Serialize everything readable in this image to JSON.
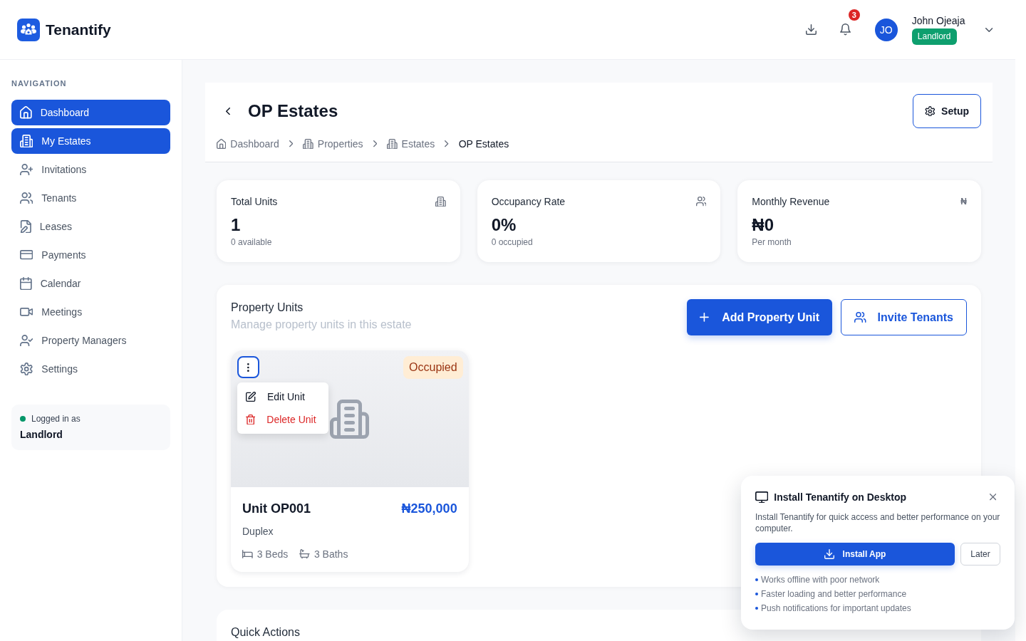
{
  "header": {
    "app_name": "Tenantify",
    "notification_count": "3",
    "user": {
      "initials": "JO",
      "name": "John Ojeaja",
      "role": "Landlord"
    }
  },
  "sidebar": {
    "heading": "NAVIGATION",
    "items": [
      {
        "label": "Dashboard",
        "selected": true
      },
      {
        "label": "My Estates",
        "selected": true
      },
      {
        "label": "Invitations",
        "selected": false
      },
      {
        "label": "Tenants",
        "selected": false
      },
      {
        "label": "Leases",
        "selected": false
      },
      {
        "label": "Payments",
        "selected": false
      },
      {
        "label": "Calendar",
        "selected": false
      },
      {
        "label": "Meetings",
        "selected": false
      },
      {
        "label": "Property Managers",
        "selected": false
      },
      {
        "label": "Settings",
        "selected": false
      }
    ],
    "session": {
      "label": "Logged in as",
      "role": "Landlord"
    }
  },
  "page": {
    "title": "OP Estates",
    "setup_button": "Setup",
    "breadcrumb": [
      {
        "label": "Dashboard",
        "current": false
      },
      {
        "label": "Properties",
        "current": false
      },
      {
        "label": "Estates",
        "current": false
      },
      {
        "label": "OP Estates",
        "current": true
      }
    ]
  },
  "stats": [
    {
      "title": "Total Units",
      "value": "1",
      "note": "0 available"
    },
    {
      "title": "Occupancy Rate",
      "value": "0%",
      "note": "0 occupied"
    },
    {
      "title": "Monthly Revenue",
      "value": "₦0",
      "note": "Per month",
      "symbol": "₦"
    }
  ],
  "units_section": {
    "title": "Property Units",
    "subtitle": "Manage property units in this estate",
    "add_button": "Add Property Unit",
    "invite_button": "Invite Tenants",
    "units": [
      {
        "status": "Occupied",
        "name": "Unit OP001",
        "price": "₦250,000",
        "type": "Duplex",
        "beds": "3 Beds",
        "baths": "3 Baths",
        "menu_open": true,
        "menu": [
          {
            "label": "Edit Unit",
            "kind": "edit"
          },
          {
            "label": "Delete Unit",
            "kind": "danger"
          }
        ]
      }
    ]
  },
  "quick_actions": {
    "title": "Quick Actions"
  },
  "install_prompt": {
    "title": "Install Tenantify on Desktop",
    "text": "Install Tenantify for quick access and better performance on your computer.",
    "install_button": "Install App",
    "later_button": "Later",
    "features": [
      "Works offline with poor network",
      "Faster loading and better performance",
      "Push notifications for important updates"
    ]
  }
}
